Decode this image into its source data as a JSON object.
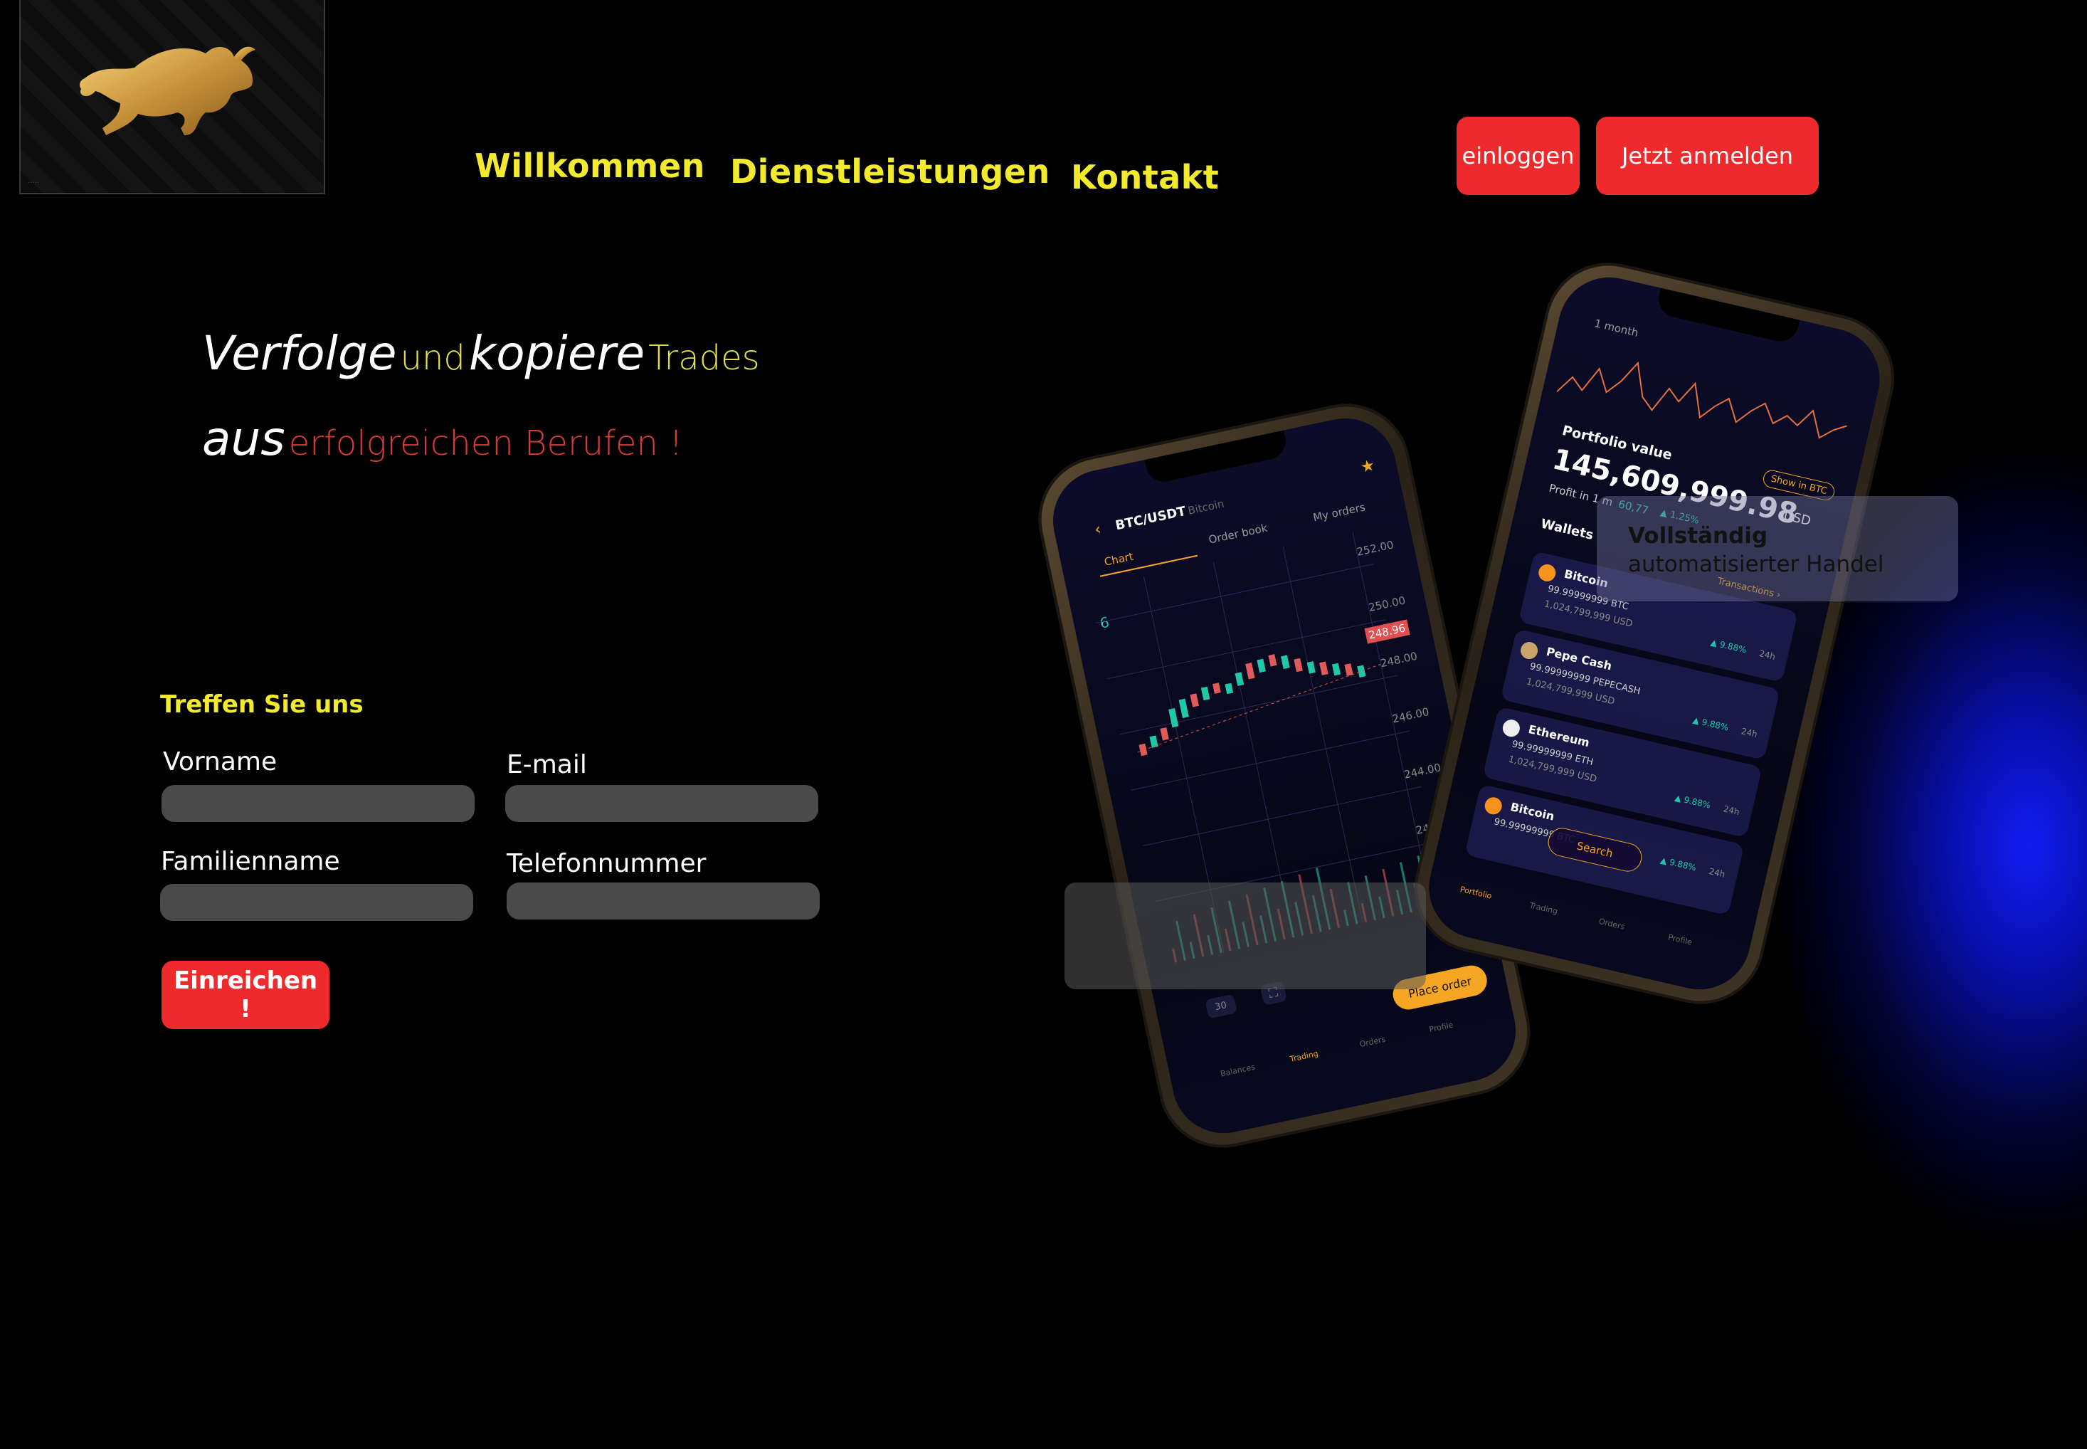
{
  "nav": {
    "items": [
      "Willkommen",
      "Dienstleistungen",
      "Kontakt"
    ],
    "login_label": "einloggen",
    "signup_label": "Jetzt anmelden"
  },
  "hero": {
    "line1": [
      "Verfolge",
      "und",
      "kopiere",
      "Trades"
    ],
    "line2": [
      "aus",
      "erfolgreichen Berufen !"
    ]
  },
  "form": {
    "title": "Treffen Sie uns",
    "fields": {
      "first_name": "Vorname",
      "email": "E-mail",
      "last_name": "Familienname",
      "phone": "Telefonnummer"
    },
    "submit_label": "Einreichen !"
  },
  "feature_card": {
    "bold": "Vollständig",
    "rest": " automatisierter Handel"
  },
  "phone_trading": {
    "pair": "BTC/USDT",
    "pair_sub": "Bitcoin",
    "tabs": [
      "Chart",
      "Order book",
      "My orders"
    ],
    "interval": "6",
    "prices": [
      "252.00",
      "250.00",
      "248.00",
      "246.00",
      "244.00",
      "24"
    ],
    "current_price": "248.96",
    "period": "30",
    "place_order": "Place order",
    "bottom_nav": [
      "Balances",
      "Trading",
      "Orders",
      "Profile"
    ]
  },
  "phone_portfolio": {
    "range": "1 month",
    "portfolio_label": "Portfolio value",
    "portfolio_value": "145,609,999.98",
    "currency": "USD",
    "show_btn": "Show in BTC",
    "profit_label": "Profit in 1 m",
    "profit_value": "60,77",
    "profit_pct": "▲ 1.25%",
    "wallets_label": "Wallets",
    "transactions": "Transactions ›",
    "wallets": [
      {
        "name": "Bitcoin",
        "amount": "99.99999999 BTC",
        "usd": "1,024,799,999 USD",
        "change": "▲ 9.88%",
        "period": "24h"
      },
      {
        "name": "Pepe Cash",
        "amount": "99.99999999 PEPECASH",
        "usd": "1,024,799,999 USD",
        "change": "▲ 9.88%",
        "period": "24h"
      },
      {
        "name": "Ethereum",
        "amount": "99.99999999 ETH",
        "usd": "1,024,799,999 USD",
        "change": "▲ 9.88%",
        "period": "24h"
      },
      {
        "name": "Bitcoin",
        "amount": "99.99999999 BTC",
        "usd": "",
        "change": "▲ 9.88%",
        "period": "24h"
      }
    ],
    "search": "Search",
    "bottom_nav": [
      "Portfolio",
      "Trading",
      "Orders",
      "Profile"
    ]
  },
  "colors": {
    "accent_yellow": "#f2ea2e",
    "accent_red": "#ee2a2c",
    "background": "#000000",
    "glow_blue": "#1420ff"
  }
}
